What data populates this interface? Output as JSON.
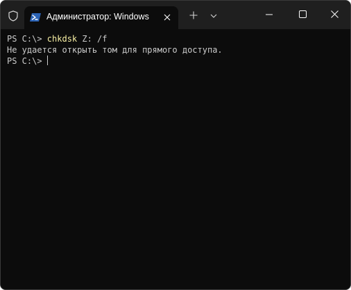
{
  "window": {
    "tab": {
      "title": "Администратор: Windows",
      "icon": "powershell-icon"
    },
    "icons": {
      "shield": "shield-icon",
      "close_tab": "close-icon",
      "new_tab": "plus-icon",
      "dropdown": "chevron-down-icon",
      "minimize": "minimize-icon",
      "maximize": "maximize-icon",
      "close": "close-icon"
    }
  },
  "terminal": {
    "lines": [
      {
        "prompt": "PS C:\\> ",
        "command": "chkdsk",
        "args": " Z: /f"
      },
      {
        "output": "Не удается открыть том для прямого доступа."
      },
      {
        "prompt": "PS C:\\> "
      }
    ]
  },
  "colors": {
    "terminal_bg": "#0c0c0c",
    "titlebar_bg": "#1f1f1f",
    "text": "#cccccc",
    "command": "#f9f1a5",
    "ps_icon_bg": "#2b63b5"
  }
}
